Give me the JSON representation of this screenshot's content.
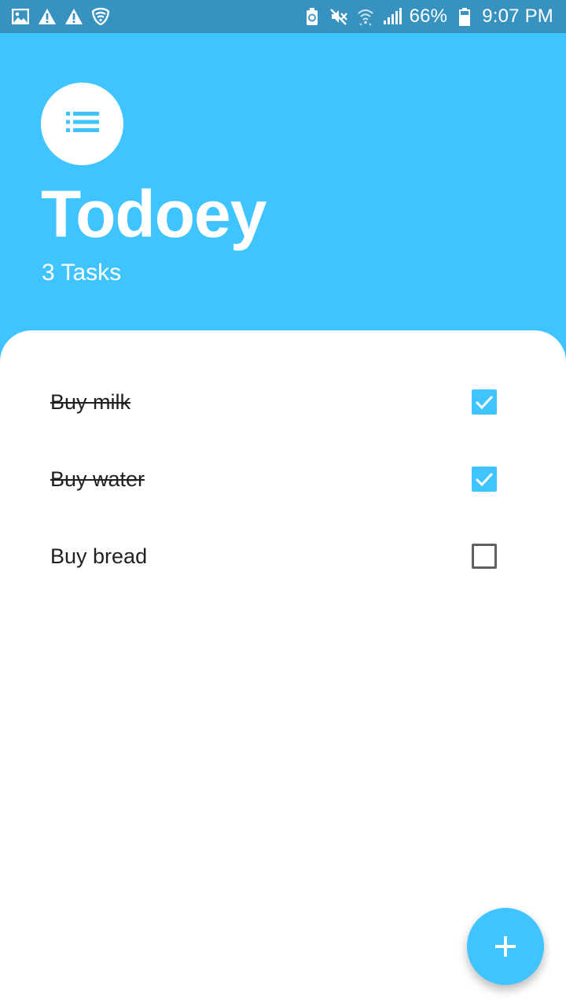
{
  "status_bar": {
    "battery_percent": "66%",
    "time": "9:07 PM",
    "left_icons": [
      "image-icon",
      "warning-icon",
      "warning-icon",
      "shield-icon"
    ],
    "right_icons": [
      "battery-saver-icon",
      "mute-icon",
      "wifi-icon",
      "signal-icon",
      "battery-icon"
    ]
  },
  "header": {
    "icon": "list-icon",
    "title": "Todoey",
    "task_count": "3 Tasks"
  },
  "tasks": [
    {
      "label": "Buy milk",
      "done": true
    },
    {
      "label": "Buy water",
      "done": true
    },
    {
      "label": "Buy bread",
      "done": false
    }
  ],
  "fab": {
    "icon": "plus-icon"
  },
  "colors": {
    "primary": "#40C4FF",
    "status_bar": "#3792BF",
    "text": "#212121"
  }
}
